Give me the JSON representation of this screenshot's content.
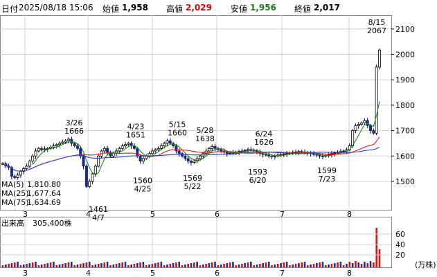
{
  "header": {
    "code_label": "日付",
    "datetime": "2025/08/18 15:06",
    "open_label": "始値",
    "open_value": "1,958",
    "high_label": "高値",
    "high_value": "2,029",
    "low_label": "安値",
    "low_value": "1,956",
    "close_label": "終値",
    "close_value": "2,017"
  },
  "colors": {
    "up": "#0a7a1a",
    "down": "#d40000",
    "grid": "#d0d0d0",
    "ma5": "#1a8a1a",
    "ma25": "#e02020",
    "ma75": "#2a3fd8",
    "volume": "#d41010",
    "volume_alt": "#20308c",
    "volume_current": "#e01414"
  },
  "price_chart": {
    "y_ticks": [
      "2100",
      "2000",
      "1900",
      "1800",
      "1700",
      "1600",
      "1500"
    ],
    "x_ticks": [
      "3",
      "4",
      "5",
      "6",
      "7",
      "8"
    ],
    "ma_legend": [
      {
        "label": "MA(5)",
        "value": "1,810.80",
        "color": "#1a8a1a"
      },
      {
        "label": "MA(25)",
        "value": "1,677.64",
        "color": "#e02020"
      },
      {
        "label": "MA(75)",
        "value": "1,634.69",
        "color": "#2a3fd8"
      }
    ],
    "annotations": [
      {
        "date": "3/26",
        "price": "1666"
      },
      {
        "date": "4/7",
        "price": "1461"
      },
      {
        "date": "4/23",
        "price": "1651"
      },
      {
        "date": "4/25",
        "price": "1560"
      },
      {
        "date": "5/15",
        "price": "1660"
      },
      {
        "date": "5/22",
        "price": "1569"
      },
      {
        "date": "5/28",
        "price": "1638"
      },
      {
        "date": "6/24",
        "price": "1626"
      },
      {
        "date": "6/20",
        "price": "1593"
      },
      {
        "date": "7/23",
        "price": "1599"
      },
      {
        "date": "8/15",
        "price": "2067"
      }
    ]
  },
  "volume_chart": {
    "label": "出来高",
    "value": "305,400株",
    "y_ticks": [
      "60",
      "40",
      "20"
    ],
    "unit": "(万株)"
  }
}
